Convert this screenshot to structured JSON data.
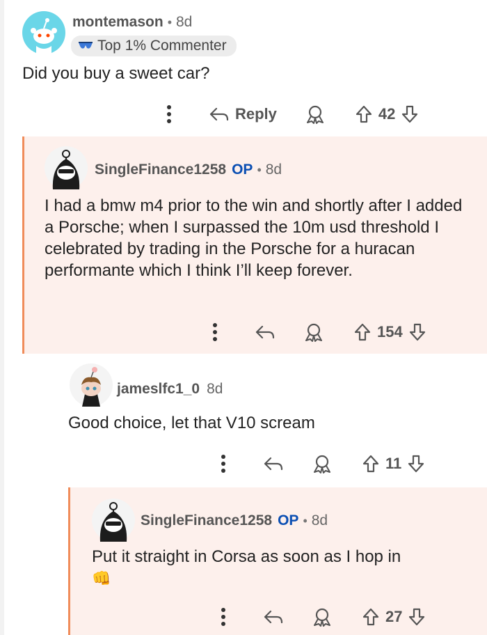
{
  "comments": [
    {
      "username": "montemason",
      "time": "8d",
      "flair": "Top 1% Commenter",
      "body": "Did you buy a sweet car?",
      "reply_label": "Reply",
      "votes": "42"
    },
    {
      "username": "SingleFinance1258",
      "op_tag": "OP",
      "time": "8d",
      "body": "I had a bmw m4 prior to the win and shortly after I added a Porsche; when I surpassed the 10m usd threshold I celebrated by trading in the Porsche for a huracan performante which I think I’ll keep forever.",
      "votes": "154"
    },
    {
      "username": "jameslfc1_0",
      "time": "8d",
      "body": "Good choice, let that V10 scream",
      "votes": "11"
    },
    {
      "username": "SingleFinance1258",
      "op_tag": "OP",
      "time": "8d",
      "body": "Put it straight in Corsa as soon as I hop in",
      "emoji": "👊",
      "votes": "27"
    }
  ],
  "icons": {
    "more": "kebab-icon",
    "reply": "reply-arrow-icon",
    "award": "award-icon",
    "upvote": "upvote-arrow-icon",
    "downvote": "downvote-arrow-icon"
  },
  "colors": {
    "highlight_bg": "#fdf0ec",
    "thread_bar": "#f08c5a",
    "op_blue": "#0b4fb3"
  }
}
